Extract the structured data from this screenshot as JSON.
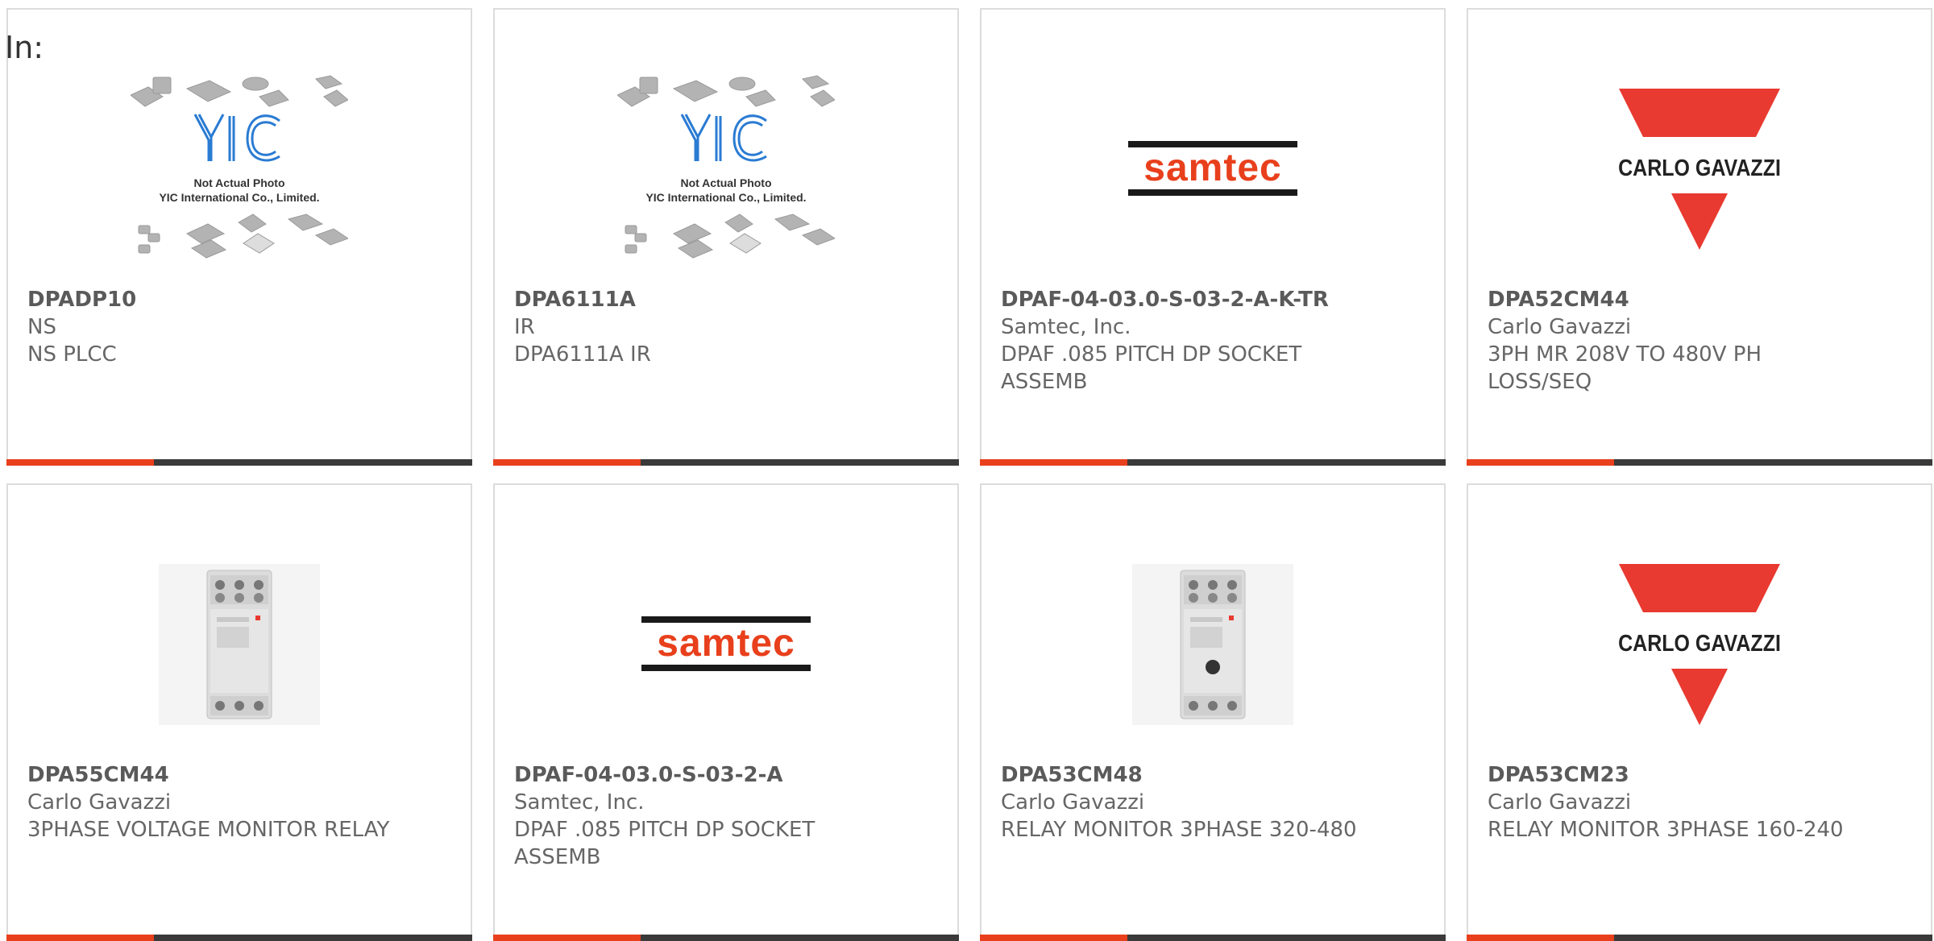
{
  "header": {
    "label": "In:"
  },
  "products": [
    {
      "part_number": "DPADP10",
      "manufacturer": "NS",
      "description": "NS PLCC",
      "image": "yic-placeholder",
      "image_text": {
        "line1": "Not Actual Photo",
        "line2": "YIC International Co., Limited.",
        "logo": "YIC"
      }
    },
    {
      "part_number": "DPA6111A",
      "manufacturer": "IR",
      "description": "DPA6111A IR",
      "image": "yic-placeholder",
      "image_text": {
        "line1": "Not Actual Photo",
        "line2": "YIC International Co., Limited.",
        "logo": "YIC"
      }
    },
    {
      "part_number": "DPAF-04-03.0-S-03-2-A-K-TR",
      "manufacturer": "Samtec, Inc.",
      "description": "DPAF .085 PITCH DP SOCKET ASSEMB",
      "image": "samtec-logo",
      "image_text": {
        "logo": "samtec"
      }
    },
    {
      "part_number": "DPA52CM44",
      "manufacturer": "Carlo Gavazzi",
      "description": "3PH MR 208V TO 480V PH LOSS/SEQ",
      "image": "carlo-gavazzi-logo",
      "image_text": {
        "logo": "CARLO GAVAZZI"
      }
    },
    {
      "part_number": "DPA55CM44",
      "manufacturer": "Carlo Gavazzi",
      "description": "3PHASE VOLTAGE MONITOR RELAY",
      "image": "relay-module-photo",
      "image_text": {}
    },
    {
      "part_number": "DPAF-04-03.0-S-03-2-A",
      "manufacturer": "Samtec, Inc.",
      "description": "DPAF .085 PITCH DP SOCKET ASSEMB",
      "image": "samtec-logo",
      "image_text": {
        "logo": "samtec"
      }
    },
    {
      "part_number": "DPA53CM48",
      "manufacturer": "Carlo Gavazzi",
      "description": "RELAY MONITOR 3PHASE 320-480",
      "image": "relay-module-photo-knob",
      "image_text": {}
    },
    {
      "part_number": "DPA53CM23",
      "manufacturer": "Carlo Gavazzi",
      "description": "RELAY MONITOR 3PHASE 160-240",
      "image": "carlo-gavazzi-logo",
      "image_text": {
        "logo": "CARLO GAVAZZI"
      }
    }
  ],
  "colors": {
    "accent": "#e8401c",
    "bar": "#3a3a3a",
    "text": "#666666",
    "samtec": "#e8401c",
    "carlo": "#e83a30"
  }
}
